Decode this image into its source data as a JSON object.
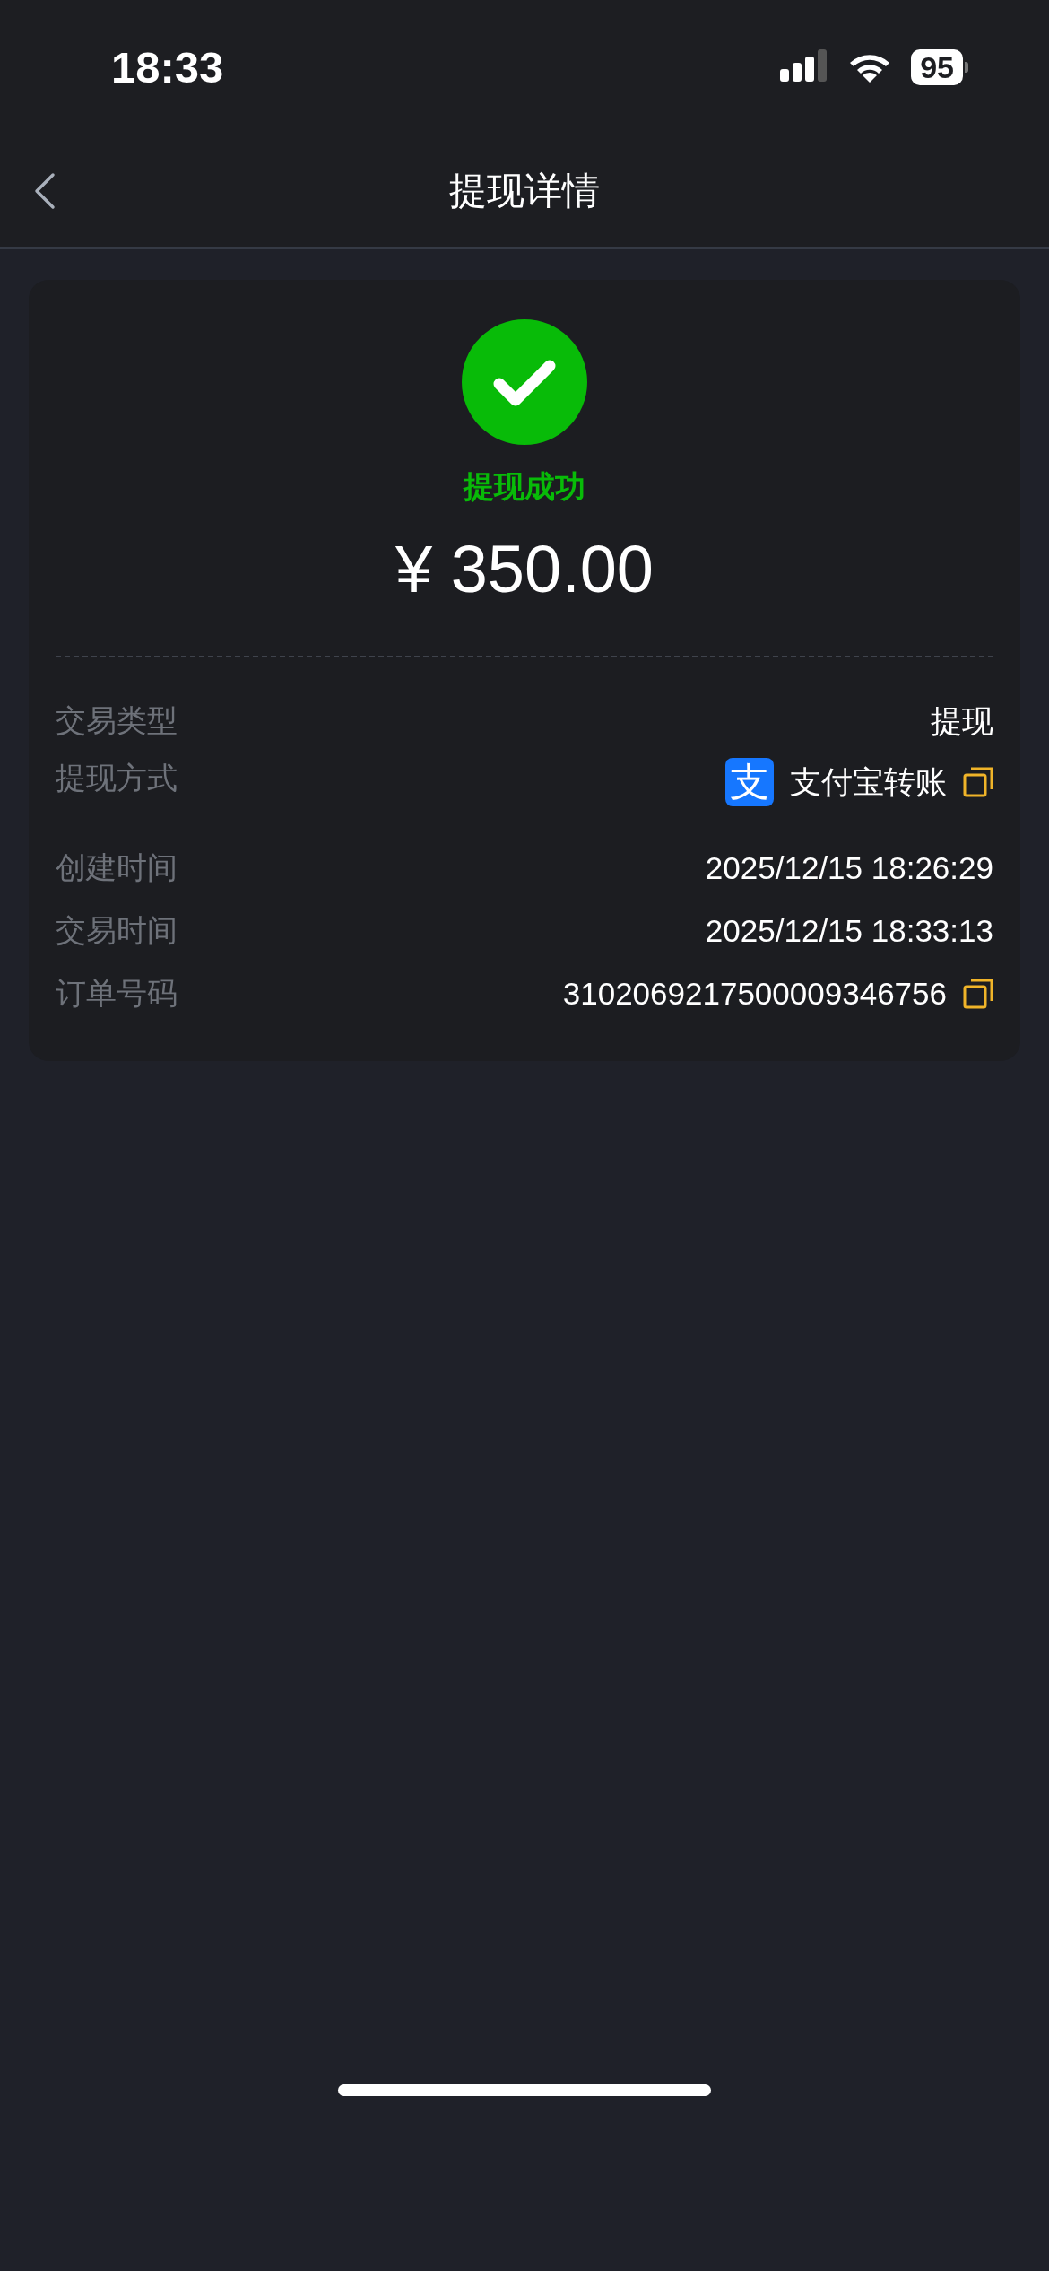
{
  "status_bar": {
    "time": "18:33",
    "battery": "95"
  },
  "nav": {
    "title": "提现详情"
  },
  "result": {
    "kind": "success",
    "status_text": "提现成功",
    "amount": "¥ 350.00"
  },
  "details": [
    {
      "label": "交易类型",
      "value": "提现",
      "copyable": false
    },
    {
      "label": "提现方式",
      "value": "支付宝转账",
      "logo_text": "支",
      "copyable": true
    },
    {
      "label": "创建时间",
      "value": "2025/12/15 18:26:29",
      "copyable": false
    },
    {
      "label": "交易时间",
      "value": "2025/12/15 18:33:13",
      "copyable": false
    },
    {
      "label": "订单号码",
      "value": "3102069217500009346756",
      "copyable": true
    }
  ]
}
